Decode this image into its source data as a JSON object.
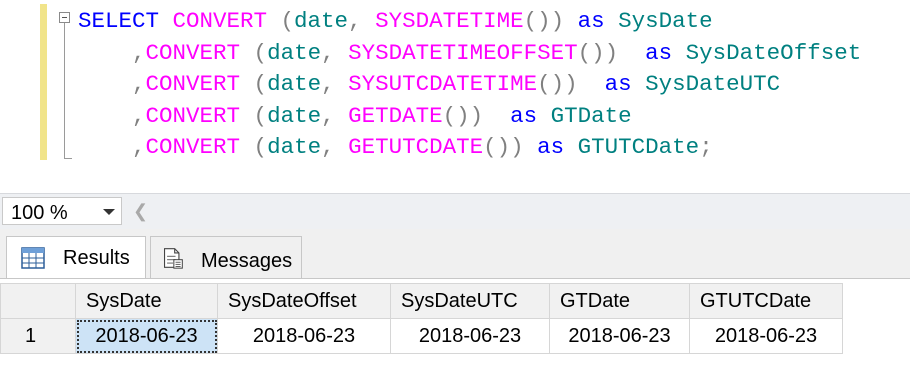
{
  "editor": {
    "lines": [
      [
        [
          "kw",
          "SELECT "
        ],
        [
          "fn",
          "CONVERT"
        ],
        [
          "op",
          " ("
        ],
        [
          "tx",
          "date"
        ],
        [
          "op",
          ", "
        ],
        [
          "fn",
          "SYSDATETIME"
        ],
        [
          "op",
          "()) "
        ],
        [
          "kw",
          "as "
        ],
        [
          "tx",
          "SysDate"
        ]
      ],
      [
        [
          "tx",
          "    "
        ],
        [
          "op",
          ","
        ],
        [
          "fn",
          "CONVERT"
        ],
        [
          "op",
          " ("
        ],
        [
          "tx",
          "date"
        ],
        [
          "op",
          ", "
        ],
        [
          "fn",
          "SYSDATETIMEOFFSET"
        ],
        [
          "op",
          "())  "
        ],
        [
          "kw",
          "as "
        ],
        [
          "tx",
          "SysDateOffset"
        ]
      ],
      [
        [
          "tx",
          "    "
        ],
        [
          "op",
          ","
        ],
        [
          "fn",
          "CONVERT"
        ],
        [
          "op",
          " ("
        ],
        [
          "tx",
          "date"
        ],
        [
          "op",
          ", "
        ],
        [
          "fn",
          "SYSUTCDATETIME"
        ],
        [
          "op",
          "())  "
        ],
        [
          "kw",
          "as "
        ],
        [
          "tx",
          "SysDateUTC"
        ]
      ],
      [
        [
          "tx",
          "    "
        ],
        [
          "op",
          ","
        ],
        [
          "fn",
          "CONVERT"
        ],
        [
          "op",
          " ("
        ],
        [
          "tx",
          "date"
        ],
        [
          "op",
          ", "
        ],
        [
          "fn",
          "GETDATE"
        ],
        [
          "op",
          "())  "
        ],
        [
          "kw",
          "as "
        ],
        [
          "tx",
          "GTDate"
        ]
      ],
      [
        [
          "tx",
          "    "
        ],
        [
          "op",
          ","
        ],
        [
          "fn",
          "CONVERT"
        ],
        [
          "op",
          " ("
        ],
        [
          "tx",
          "date"
        ],
        [
          "op",
          ", "
        ],
        [
          "fn",
          "GETUTCDATE"
        ],
        [
          "op",
          "()) "
        ],
        [
          "kw",
          "as "
        ],
        [
          "tx",
          "GTUTCDate"
        ],
        [
          "op",
          ";"
        ]
      ]
    ]
  },
  "zoom": {
    "value": "100 %"
  },
  "tabs": {
    "results_label": "Results",
    "messages_label": "Messages"
  },
  "grid": {
    "columns": [
      "SysDate",
      "SysDateOffset",
      "SysDateUTC",
      "GTDate",
      "GTUTCDate"
    ],
    "rows": [
      {
        "num": "1",
        "cells": [
          "2018-06-23",
          "2018-06-23",
          "2018-06-23",
          "2018-06-23",
          "2018-06-23"
        ]
      }
    ]
  },
  "colors": {
    "keyword": "#0000ff",
    "function": "#ff00ff",
    "text": "#008080",
    "operator": "#808080",
    "selected_cell": "#cde3f6"
  }
}
